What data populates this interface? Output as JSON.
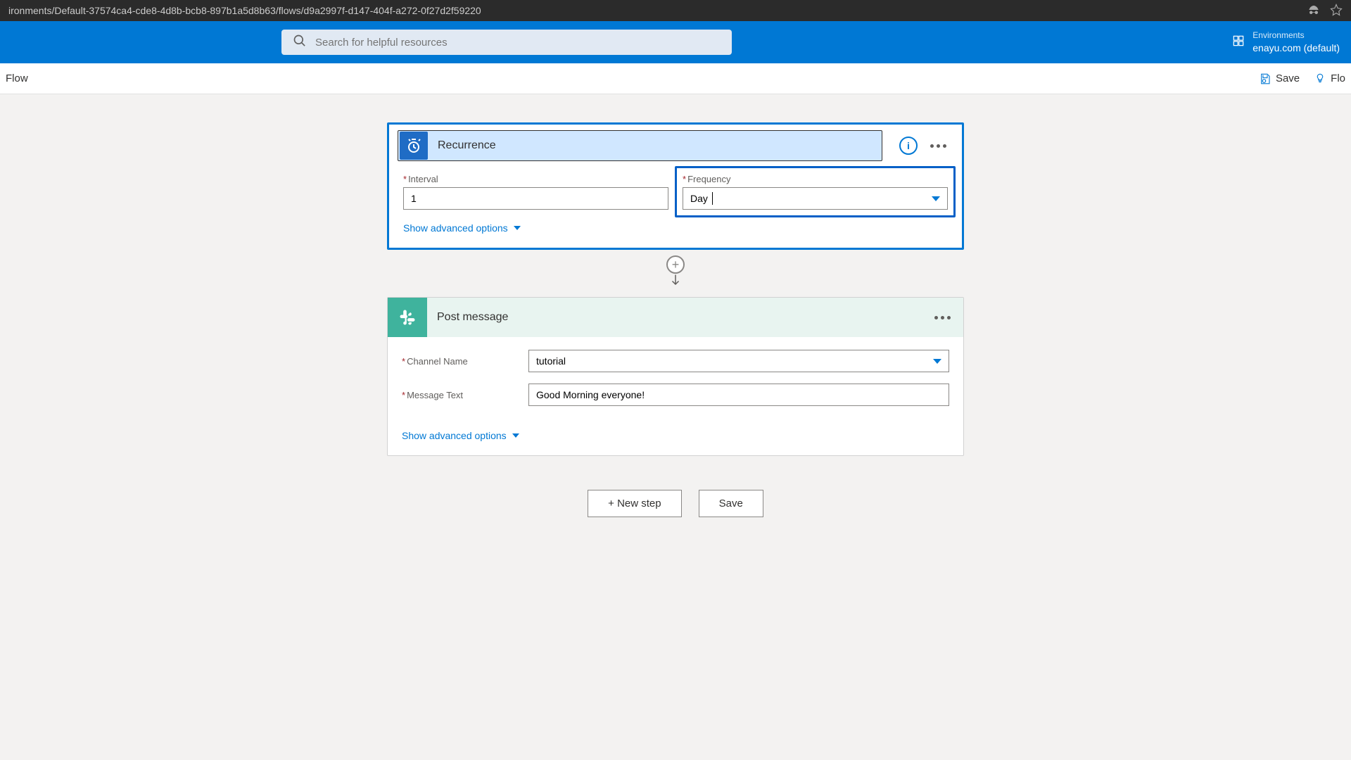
{
  "browser": {
    "url": "ironments/Default-37574ca4-cde8-4d8b-bcb8-897b1a5d8b63/flows/d9a2997f-d147-404f-a272-0f27d2f59220"
  },
  "header": {
    "search_placeholder": "Search for helpful resources",
    "env_label": "Environments",
    "env_name": "enayu.com (default)"
  },
  "commandbar": {
    "left": "Flow",
    "save": "Save",
    "flow_checker": "Flo"
  },
  "recurrence": {
    "title": "Recurrence",
    "interval_label": "Interval",
    "interval_value": "1",
    "frequency_label": "Frequency",
    "frequency_value": "Day",
    "advanced": "Show advanced options"
  },
  "post": {
    "title": "Post message",
    "channel_label": "Channel Name",
    "channel_value": "tutorial",
    "message_label": "Message Text",
    "message_value": "Good Morning everyone!",
    "advanced": "Show advanced options"
  },
  "actions": {
    "new_step": "+ New step",
    "save": "Save"
  }
}
